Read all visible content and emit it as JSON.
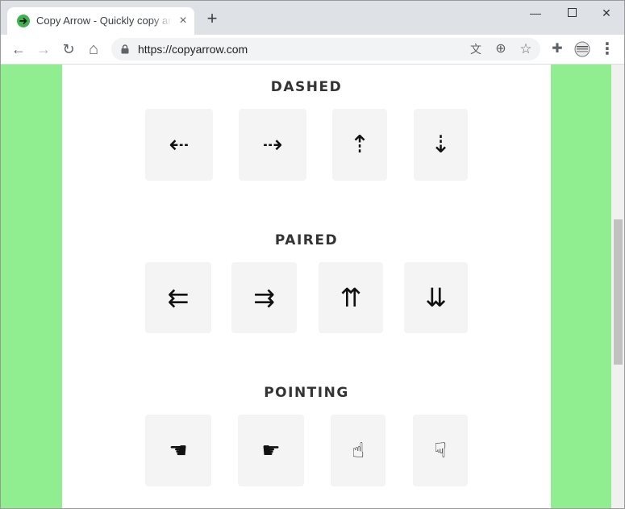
{
  "browser": {
    "tab_title": "Copy Arrow - Quickly copy arrows",
    "url": "https://copyarrow.com",
    "new_tab": "+",
    "close_tab": "×",
    "win_min": "—",
    "win_close": "✕"
  },
  "toolbar": {
    "back_icon": "←",
    "forward_icon": "→",
    "reload_icon": "↻",
    "home_icon": "⌂",
    "translate_icon": "文",
    "zoom_icon": "⊕",
    "star_icon": "☆",
    "extensions_icon": "✚",
    "menu_icon": "⋮"
  },
  "sections": [
    {
      "title": "DASHED",
      "arrows": [
        "⇠",
        "⇢",
        "⇡",
        "⇣"
      ]
    },
    {
      "title": "PAIRED",
      "arrows": [
        "⇇",
        "⇉",
        "⇈",
        "⇊"
      ]
    },
    {
      "title": "POINTING",
      "arrows": [
        "☚",
        "☛",
        "☝",
        "☟"
      ]
    }
  ],
  "colors": {
    "side_background": "#90ee90",
    "card_background": "#f4f4f4",
    "favicon": "#3fb24f"
  }
}
